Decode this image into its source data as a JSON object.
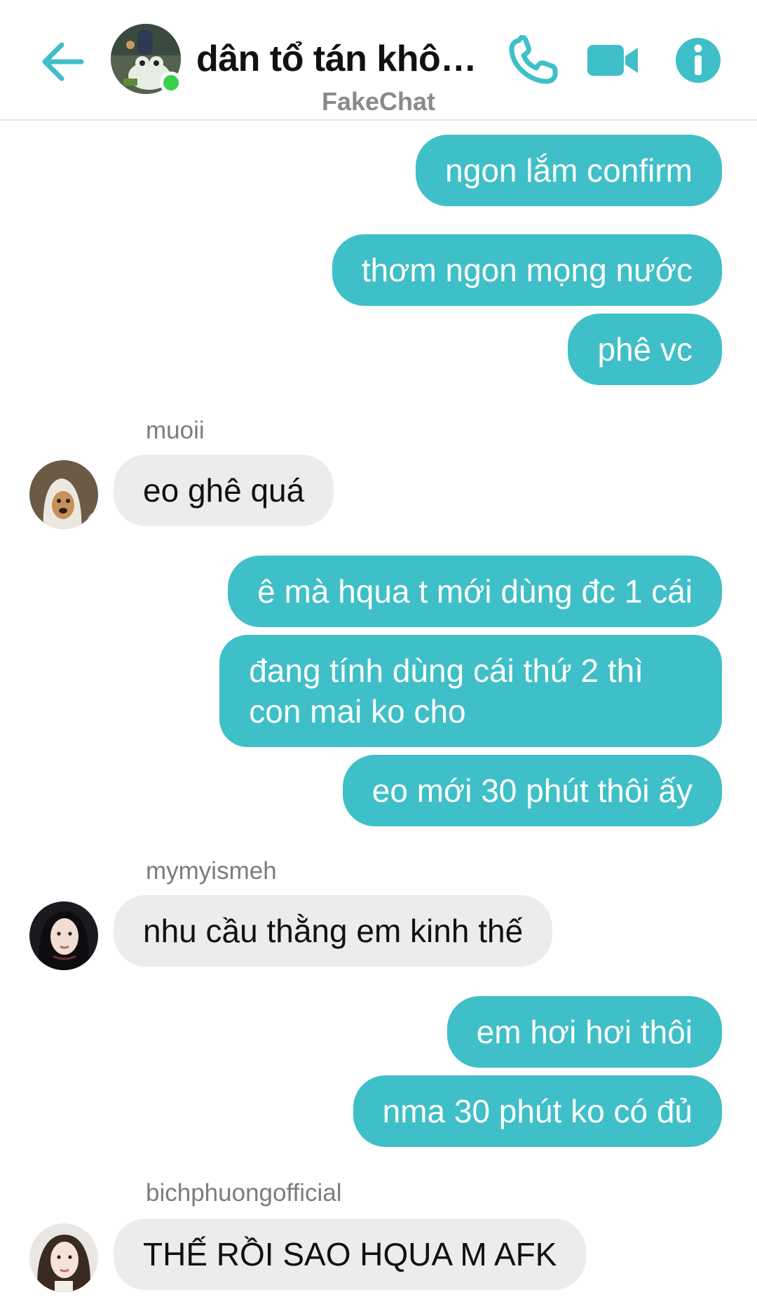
{
  "header": {
    "title": "dân tổ tán khôn...",
    "subtitle": "FakeChat",
    "icons": [
      "back-arrow-icon",
      "phone-icon",
      "video-camera-icon",
      "info-icon"
    ],
    "accent_color": "#3fbfc7",
    "online_color": "#3bd04c"
  },
  "messages": [
    {
      "direction": "out",
      "text": "ngon lắm confirm"
    },
    {
      "direction": "out",
      "text": "thơm ngon mọng nước"
    },
    {
      "direction": "out",
      "text": "phê vc"
    },
    {
      "direction": "in",
      "sender": "muoii",
      "text": "eo ghê quá"
    },
    {
      "direction": "out",
      "text": "ê mà hqua t mới dùng đc 1 cái"
    },
    {
      "direction": "out",
      "text_line1": "đang tính dùng cái thứ 2 thì",
      "text_line2": "con mai ko cho"
    },
    {
      "direction": "out",
      "text": "eo mới 30 phút thôi ấy"
    },
    {
      "direction": "in",
      "sender": "mymyismeh",
      "text": "nhu cầu thằng em kinh thế"
    },
    {
      "direction": "out",
      "text": "em hơi hơi thôi"
    },
    {
      "direction": "out",
      "text": "nma 30 phút ko có đủ"
    },
    {
      "direction": "in",
      "sender": "bichphuongofficial",
      "text": "THẾ RỒI SAO HQUA M AFK"
    }
  ]
}
